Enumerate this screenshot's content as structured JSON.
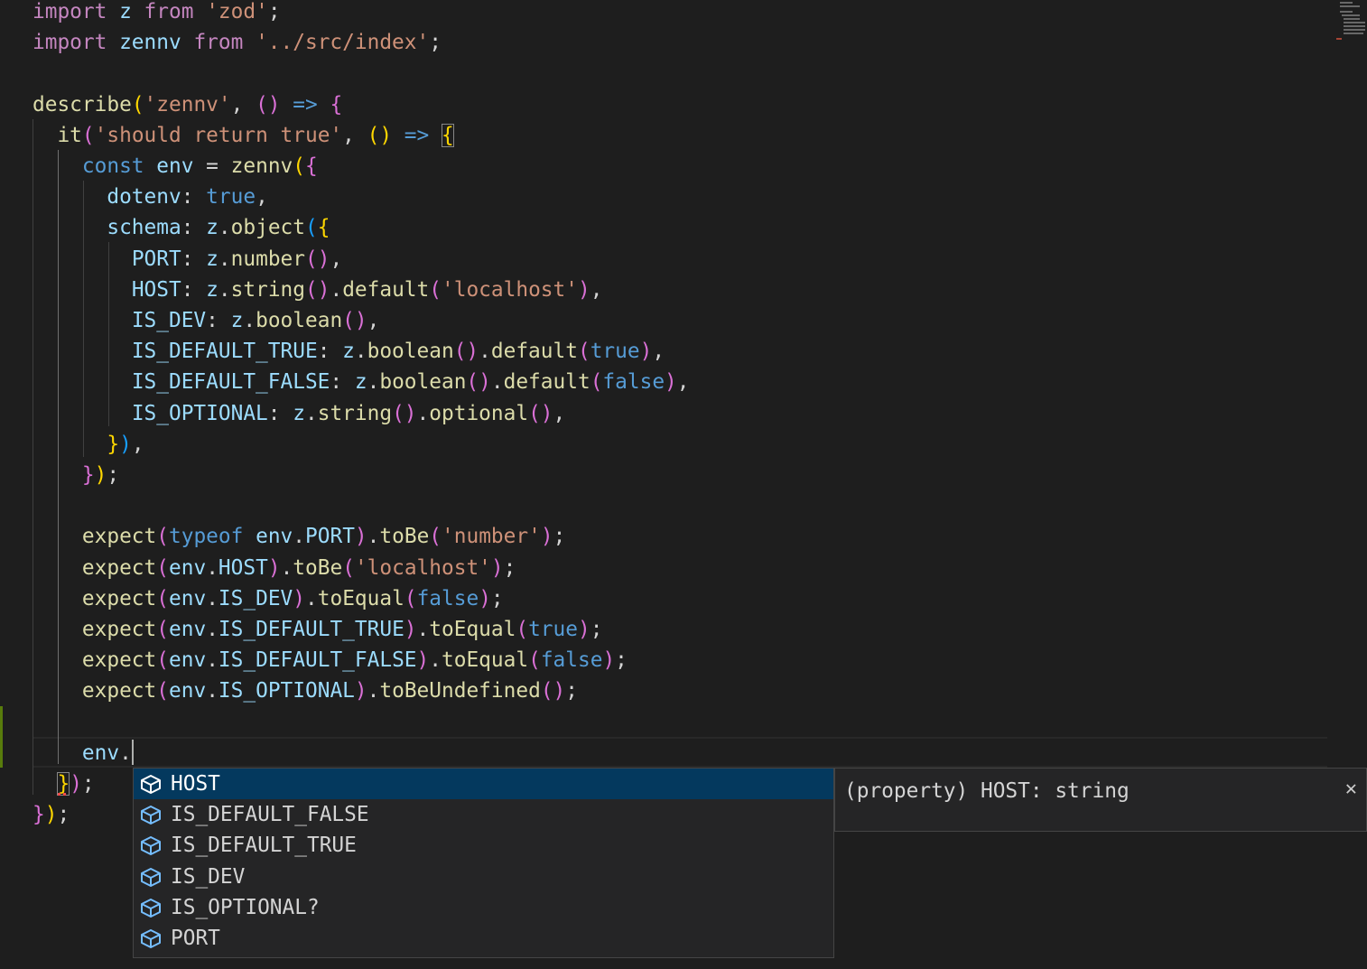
{
  "theme": {
    "background": "#1e1e1e",
    "keyword": "#c586c0",
    "storage": "#569cd6",
    "string": "#ce9178",
    "variable": "#9cdcfe",
    "function": "#dcdcaa",
    "bracket_level_1": "#ffd700",
    "bracket_level_2": "#da70d6",
    "bracket_level_3": "#179fff",
    "selection_highlight": "#04395e",
    "gutter_modified": "#587c0c"
  },
  "editor": {
    "lines": [
      [
        {
          "t": "import",
          "c": "kw"
        },
        {
          "t": " z ",
          "c": "var"
        },
        {
          "t": "from",
          "c": "kw"
        },
        {
          "t": " ",
          "c": "plain"
        },
        {
          "t": "'zod'",
          "c": "str"
        },
        {
          "t": ";",
          "c": "plain"
        }
      ],
      [
        {
          "t": "import",
          "c": "kw"
        },
        {
          "t": " zennv ",
          "c": "var"
        },
        {
          "t": "from",
          "c": "kw"
        },
        {
          "t": " ",
          "c": "plain"
        },
        {
          "t": "'../src/index'",
          "c": "str"
        },
        {
          "t": ";",
          "c": "plain"
        }
      ],
      [],
      [
        {
          "t": "describe",
          "c": "fn"
        },
        {
          "t": "(",
          "c": "b1"
        },
        {
          "t": "'zennv'",
          "c": "str"
        },
        {
          "t": ", ",
          "c": "plain"
        },
        {
          "t": "()",
          "c": "b2"
        },
        {
          "t": " ",
          "c": "plain"
        },
        {
          "t": "=>",
          "c": "st"
        },
        {
          "t": " ",
          "c": "plain"
        },
        {
          "t": "{",
          "c": "b2"
        }
      ],
      [
        {
          "t": "  ",
          "c": "plain"
        },
        {
          "t": "it",
          "c": "fn"
        },
        {
          "t": "(",
          "c": "b2"
        },
        {
          "t": "'should return true'",
          "c": "str"
        },
        {
          "t": ", ",
          "c": "plain"
        },
        {
          "t": "()",
          "c": "b1"
        },
        {
          "t": " ",
          "c": "plain"
        },
        {
          "t": "=>",
          "c": "st"
        },
        {
          "t": " ",
          "c": "plain"
        },
        {
          "t": "{",
          "c": "b1",
          "m": true
        }
      ],
      [
        {
          "t": "    ",
          "c": "plain"
        },
        {
          "t": "const",
          "c": "st"
        },
        {
          "t": " ",
          "c": "plain"
        },
        {
          "t": "env",
          "c": "var"
        },
        {
          "t": " = ",
          "c": "plain"
        },
        {
          "t": "zennv",
          "c": "fn"
        },
        {
          "t": "(",
          "c": "b1"
        },
        {
          "t": "{",
          "c": "b2"
        }
      ],
      [
        {
          "t": "      ",
          "c": "plain"
        },
        {
          "t": "dotenv",
          "c": "var"
        },
        {
          "t": ": ",
          "c": "plain"
        },
        {
          "t": "true",
          "c": "st"
        },
        {
          "t": ",",
          "c": "plain"
        }
      ],
      [
        {
          "t": "      ",
          "c": "plain"
        },
        {
          "t": "schema",
          "c": "var"
        },
        {
          "t": ": ",
          "c": "plain"
        },
        {
          "t": "z",
          "c": "var"
        },
        {
          "t": ".",
          "c": "plain"
        },
        {
          "t": "object",
          "c": "fn"
        },
        {
          "t": "(",
          "c": "b3"
        },
        {
          "t": "{",
          "c": "b1"
        }
      ],
      [
        {
          "t": "        ",
          "c": "plain"
        },
        {
          "t": "PORT",
          "c": "var"
        },
        {
          "t": ": ",
          "c": "plain"
        },
        {
          "t": "z",
          "c": "var"
        },
        {
          "t": ".",
          "c": "plain"
        },
        {
          "t": "number",
          "c": "fn"
        },
        {
          "t": "()",
          "c": "b2"
        },
        {
          "t": ",",
          "c": "plain"
        }
      ],
      [
        {
          "t": "        ",
          "c": "plain"
        },
        {
          "t": "HOST",
          "c": "var"
        },
        {
          "t": ": ",
          "c": "plain"
        },
        {
          "t": "z",
          "c": "var"
        },
        {
          "t": ".",
          "c": "plain"
        },
        {
          "t": "string",
          "c": "fn"
        },
        {
          "t": "()",
          "c": "b2"
        },
        {
          "t": ".",
          "c": "plain"
        },
        {
          "t": "default",
          "c": "fn"
        },
        {
          "t": "(",
          "c": "b2"
        },
        {
          "t": "'localhost'",
          "c": "str"
        },
        {
          "t": ")",
          "c": "b2"
        },
        {
          "t": ",",
          "c": "plain"
        }
      ],
      [
        {
          "t": "        ",
          "c": "plain"
        },
        {
          "t": "IS_DEV",
          "c": "var"
        },
        {
          "t": ": ",
          "c": "plain"
        },
        {
          "t": "z",
          "c": "var"
        },
        {
          "t": ".",
          "c": "plain"
        },
        {
          "t": "boolean",
          "c": "fn"
        },
        {
          "t": "()",
          "c": "b2"
        },
        {
          "t": ",",
          "c": "plain"
        }
      ],
      [
        {
          "t": "        ",
          "c": "plain"
        },
        {
          "t": "IS_DEFAULT_TRUE",
          "c": "var"
        },
        {
          "t": ": ",
          "c": "plain"
        },
        {
          "t": "z",
          "c": "var"
        },
        {
          "t": ".",
          "c": "plain"
        },
        {
          "t": "boolean",
          "c": "fn"
        },
        {
          "t": "()",
          "c": "b2"
        },
        {
          "t": ".",
          "c": "plain"
        },
        {
          "t": "default",
          "c": "fn"
        },
        {
          "t": "(",
          "c": "b2"
        },
        {
          "t": "true",
          "c": "st"
        },
        {
          "t": ")",
          "c": "b2"
        },
        {
          "t": ",",
          "c": "plain"
        }
      ],
      [
        {
          "t": "        ",
          "c": "plain"
        },
        {
          "t": "IS_DEFAULT_FALSE",
          "c": "var"
        },
        {
          "t": ": ",
          "c": "plain"
        },
        {
          "t": "z",
          "c": "var"
        },
        {
          "t": ".",
          "c": "plain"
        },
        {
          "t": "boolean",
          "c": "fn"
        },
        {
          "t": "()",
          "c": "b2"
        },
        {
          "t": ".",
          "c": "plain"
        },
        {
          "t": "default",
          "c": "fn"
        },
        {
          "t": "(",
          "c": "b2"
        },
        {
          "t": "false",
          "c": "st"
        },
        {
          "t": ")",
          "c": "b2"
        },
        {
          "t": ",",
          "c": "plain"
        }
      ],
      [
        {
          "t": "        ",
          "c": "plain"
        },
        {
          "t": "IS_OPTIONAL",
          "c": "var"
        },
        {
          "t": ": ",
          "c": "plain"
        },
        {
          "t": "z",
          "c": "var"
        },
        {
          "t": ".",
          "c": "plain"
        },
        {
          "t": "string",
          "c": "fn"
        },
        {
          "t": "()",
          "c": "b2"
        },
        {
          "t": ".",
          "c": "plain"
        },
        {
          "t": "optional",
          "c": "fn"
        },
        {
          "t": "()",
          "c": "b2"
        },
        {
          "t": ",",
          "c": "plain"
        }
      ],
      [
        {
          "t": "      ",
          "c": "plain"
        },
        {
          "t": "}",
          "c": "b1"
        },
        {
          "t": ")",
          "c": "b3"
        },
        {
          "t": ",",
          "c": "plain"
        }
      ],
      [
        {
          "t": "    ",
          "c": "plain"
        },
        {
          "t": "}",
          "c": "b2"
        },
        {
          "t": ")",
          "c": "b1"
        },
        {
          "t": ";",
          "c": "plain"
        }
      ],
      [],
      [
        {
          "t": "    ",
          "c": "plain"
        },
        {
          "t": "expect",
          "c": "fn"
        },
        {
          "t": "(",
          "c": "b2"
        },
        {
          "t": "typeof",
          "c": "st"
        },
        {
          "t": " ",
          "c": "plain"
        },
        {
          "t": "env",
          "c": "var"
        },
        {
          "t": ".",
          "c": "plain"
        },
        {
          "t": "PORT",
          "c": "var"
        },
        {
          "t": ")",
          "c": "b2"
        },
        {
          "t": ".",
          "c": "plain"
        },
        {
          "t": "toBe",
          "c": "fn"
        },
        {
          "t": "(",
          "c": "b2"
        },
        {
          "t": "'number'",
          "c": "str"
        },
        {
          "t": ")",
          "c": "b2"
        },
        {
          "t": ";",
          "c": "plain"
        }
      ],
      [
        {
          "t": "    ",
          "c": "plain"
        },
        {
          "t": "expect",
          "c": "fn"
        },
        {
          "t": "(",
          "c": "b2"
        },
        {
          "t": "env",
          "c": "var"
        },
        {
          "t": ".",
          "c": "plain"
        },
        {
          "t": "HOST",
          "c": "var"
        },
        {
          "t": ")",
          "c": "b2"
        },
        {
          "t": ".",
          "c": "plain"
        },
        {
          "t": "toBe",
          "c": "fn"
        },
        {
          "t": "(",
          "c": "b2"
        },
        {
          "t": "'localhost'",
          "c": "str"
        },
        {
          "t": ")",
          "c": "b2"
        },
        {
          "t": ";",
          "c": "plain"
        }
      ],
      [
        {
          "t": "    ",
          "c": "plain"
        },
        {
          "t": "expect",
          "c": "fn"
        },
        {
          "t": "(",
          "c": "b2"
        },
        {
          "t": "env",
          "c": "var"
        },
        {
          "t": ".",
          "c": "plain"
        },
        {
          "t": "IS_DEV",
          "c": "var"
        },
        {
          "t": ")",
          "c": "b2"
        },
        {
          "t": ".",
          "c": "plain"
        },
        {
          "t": "toEqual",
          "c": "fn"
        },
        {
          "t": "(",
          "c": "b2"
        },
        {
          "t": "false",
          "c": "st"
        },
        {
          "t": ")",
          "c": "b2"
        },
        {
          "t": ";",
          "c": "plain"
        }
      ],
      [
        {
          "t": "    ",
          "c": "plain"
        },
        {
          "t": "expect",
          "c": "fn"
        },
        {
          "t": "(",
          "c": "b2"
        },
        {
          "t": "env",
          "c": "var"
        },
        {
          "t": ".",
          "c": "plain"
        },
        {
          "t": "IS_DEFAULT_TRUE",
          "c": "var"
        },
        {
          "t": ")",
          "c": "b2"
        },
        {
          "t": ".",
          "c": "plain"
        },
        {
          "t": "toEqual",
          "c": "fn"
        },
        {
          "t": "(",
          "c": "b2"
        },
        {
          "t": "true",
          "c": "st"
        },
        {
          "t": ")",
          "c": "b2"
        },
        {
          "t": ";",
          "c": "plain"
        }
      ],
      [
        {
          "t": "    ",
          "c": "plain"
        },
        {
          "t": "expect",
          "c": "fn"
        },
        {
          "t": "(",
          "c": "b2"
        },
        {
          "t": "env",
          "c": "var"
        },
        {
          "t": ".",
          "c": "plain"
        },
        {
          "t": "IS_DEFAULT_FALSE",
          "c": "var"
        },
        {
          "t": ")",
          "c": "b2"
        },
        {
          "t": ".",
          "c": "plain"
        },
        {
          "t": "toEqual",
          "c": "fn"
        },
        {
          "t": "(",
          "c": "b2"
        },
        {
          "t": "false",
          "c": "st"
        },
        {
          "t": ")",
          "c": "b2"
        },
        {
          "t": ";",
          "c": "plain"
        }
      ],
      [
        {
          "t": "    ",
          "c": "plain"
        },
        {
          "t": "expect",
          "c": "fn"
        },
        {
          "t": "(",
          "c": "b2"
        },
        {
          "t": "env",
          "c": "var"
        },
        {
          "t": ".",
          "c": "plain"
        },
        {
          "t": "IS_OPTIONAL",
          "c": "var"
        },
        {
          "t": ")",
          "c": "b2"
        },
        {
          "t": ".",
          "c": "plain"
        },
        {
          "t": "toBeUndefined",
          "c": "fn"
        },
        {
          "t": "()",
          "c": "b2"
        },
        {
          "t": ";",
          "c": "plain"
        }
      ],
      [],
      [
        {
          "t": "    ",
          "c": "plain"
        },
        {
          "t": "env",
          "c": "var"
        },
        {
          "t": ".",
          "c": "plain"
        }
      ],
      [
        {
          "t": "  ",
          "c": "plain"
        },
        {
          "t": "}",
          "c": "b1",
          "m": true
        },
        {
          "t": ")",
          "c": "b2"
        },
        {
          "t": ";",
          "c": "plain"
        }
      ],
      [
        {
          "t": "}",
          "c": "b2"
        },
        {
          "t": ")",
          "c": "b1"
        },
        {
          "t": ";",
          "c": "plain"
        }
      ]
    ]
  },
  "suggest": {
    "items": [
      {
        "label": "HOST",
        "icon": "property-icon",
        "selected": true
      },
      {
        "label": "IS_DEFAULT_FALSE",
        "icon": "property-icon",
        "selected": false
      },
      {
        "label": "IS_DEFAULT_TRUE",
        "icon": "property-icon",
        "selected": false
      },
      {
        "label": "IS_DEV",
        "icon": "property-icon",
        "selected": false
      },
      {
        "label": "IS_OPTIONAL?",
        "icon": "property-icon",
        "selected": false
      },
      {
        "label": "PORT",
        "icon": "property-icon",
        "selected": false
      }
    ]
  },
  "details": {
    "signature": "(property) HOST: string",
    "close_icon": "close-icon"
  }
}
